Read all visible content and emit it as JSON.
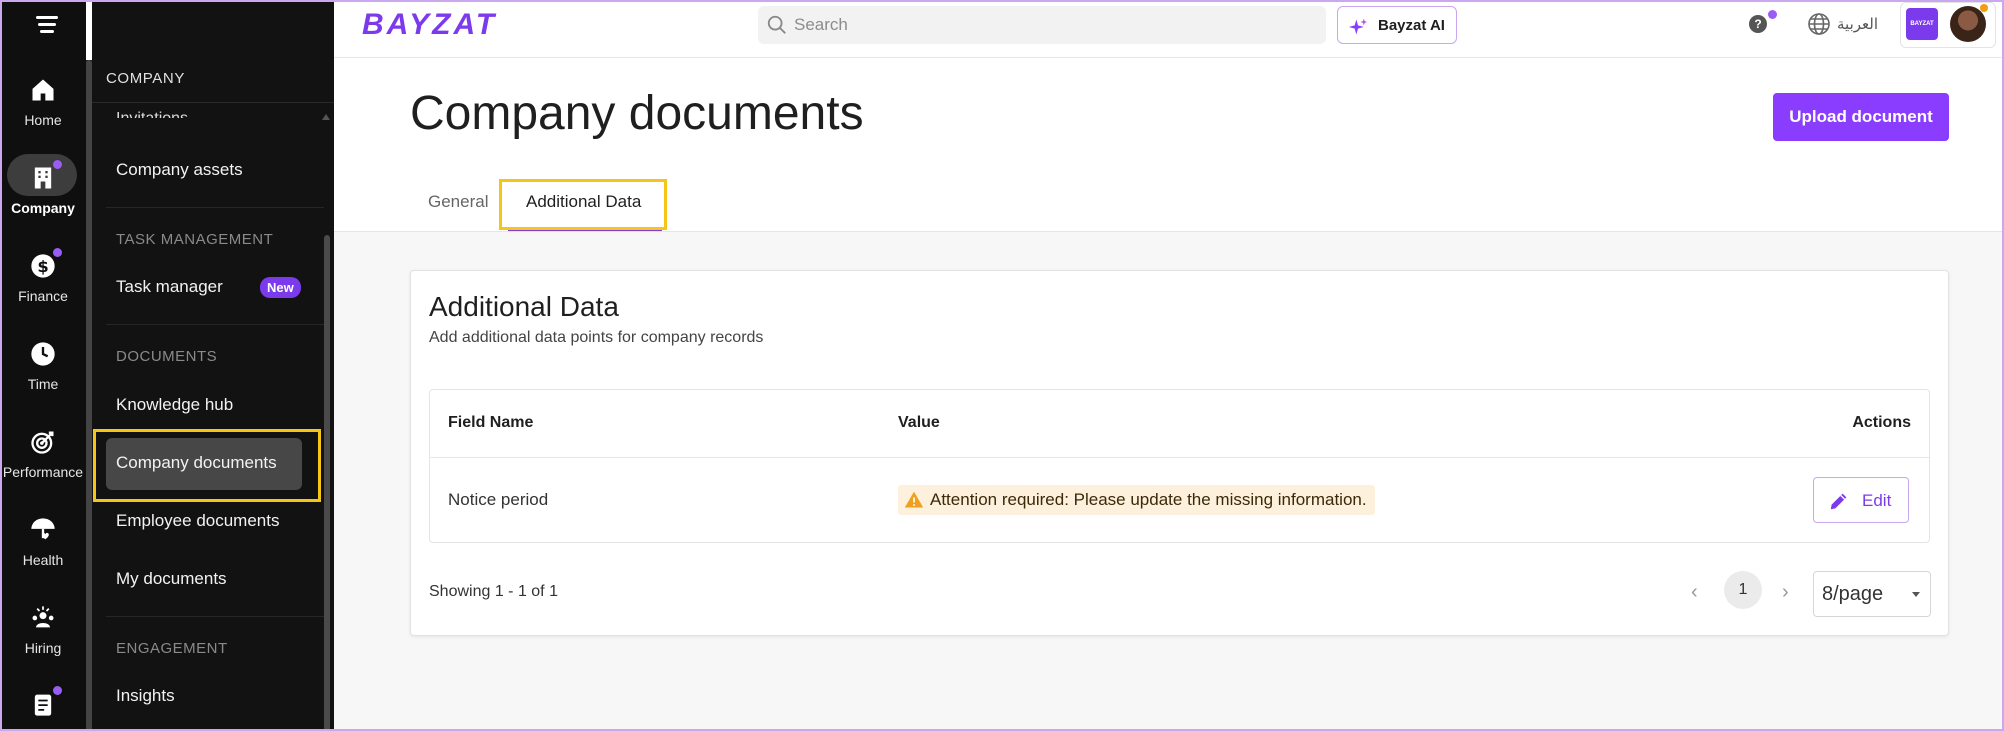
{
  "rail": {
    "items": [
      {
        "label": "Home",
        "icon": "home-icon"
      },
      {
        "label": "Company",
        "icon": "building-icon"
      },
      {
        "label": "Finance",
        "icon": "dollar-icon"
      },
      {
        "label": "Time",
        "icon": "clock-icon"
      },
      {
        "label": "Performance",
        "icon": "target-icon"
      },
      {
        "label": "Health",
        "icon": "umbrella-heart-icon"
      },
      {
        "label": "Hiring",
        "icon": "people-icon"
      },
      {
        "label": "",
        "icon": "clipboard-icon"
      }
    ]
  },
  "sidebar": {
    "header": "COMPANY",
    "cut_item": "Invitations",
    "items": {
      "company_assets": "Company assets",
      "task_manager": "Task manager",
      "new_badge": "New",
      "knowledge_hub": "Knowledge hub",
      "company_documents": "Company documents",
      "employee_documents": "Employee documents",
      "my_documents": "My documents",
      "insights": "Insights"
    },
    "sections": {
      "task_management": "TASK MANAGEMENT",
      "documents": "DOCUMENTS",
      "engagement": "ENGAGEMENT"
    }
  },
  "topbar": {
    "logo": "BAYZAT",
    "search_placeholder": "Search",
    "ai_button": "Bayzat AI",
    "help": "?",
    "language": "العربية",
    "company_logo": "BAYZAT"
  },
  "page": {
    "title": "Company documents",
    "upload_button": "Upload document",
    "tabs": [
      "General",
      "Additional Data"
    ],
    "active_tab": "Additional Data"
  },
  "card": {
    "title": "Additional Data",
    "subtitle": "Add additional data points for company records",
    "columns": [
      "Field Name",
      "Value",
      "Actions"
    ],
    "rows": [
      {
        "field": "Notice period",
        "value": "Attention required: Please update the missing information.",
        "action": "Edit"
      }
    ],
    "showing": "Showing 1 - 1 of 1",
    "page": "1",
    "page_size": "8/page"
  },
  "colors": {
    "brand": "#7c3aed",
    "primary_button": "#8b3dff",
    "highlight": "#f5c518",
    "warning_bg": "#fdf0dc"
  }
}
